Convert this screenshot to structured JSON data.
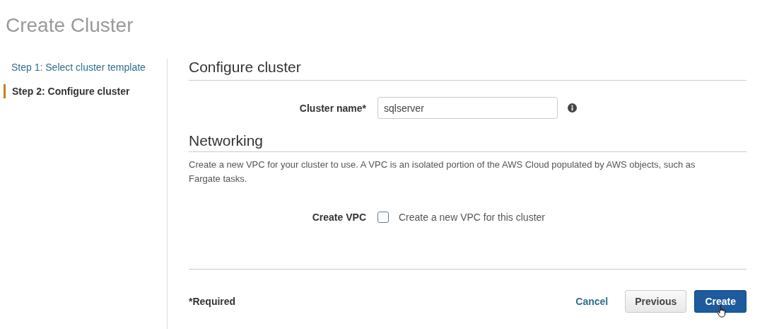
{
  "page_title": "Create Cluster",
  "steps": [
    {
      "label": "Step 1: Select cluster template",
      "selected": false
    },
    {
      "label": "Step 2: Configure cluster",
      "selected": true
    }
  ],
  "section_title": "Configure cluster",
  "cluster_name": {
    "label": "Cluster name*",
    "value": "sqlserver"
  },
  "networking": {
    "title": "Networking",
    "description": "Create a new VPC for your cluster to use. A VPC is an isolated portion of the AWS Cloud populated by AWS objects, such as Fargate tasks.",
    "create_vpc": {
      "label": "Create VPC",
      "option": "Create a new VPC for this cluster",
      "checked": false
    }
  },
  "footer": {
    "required_note": "*Required",
    "buttons": [
      {
        "label": "Cancel",
        "kind": "link"
      },
      {
        "label": "Previous",
        "kind": "secondary"
      },
      {
        "label": "Create",
        "kind": "primary",
        "hovered": true
      }
    ]
  }
}
